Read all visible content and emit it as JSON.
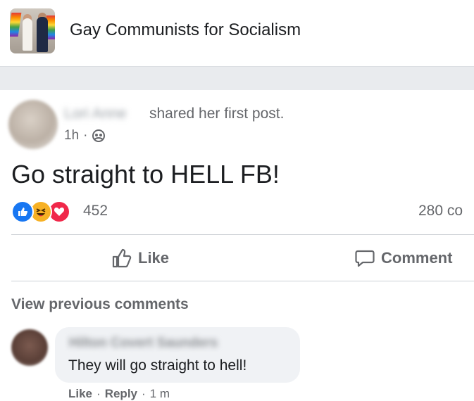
{
  "group": {
    "name": "Gay Communists for Socialism"
  },
  "post": {
    "author": "Lori Anne",
    "action": "shared her first post.",
    "time": "1h",
    "meta_separator": "·",
    "text": "Go straight to HELL FB!",
    "reaction_count": "452",
    "comment_count": "280 co",
    "reactions": [
      "like",
      "haha",
      "love"
    ],
    "actions": {
      "like_label": "Like",
      "comment_label": "Comment"
    }
  },
  "comments": {
    "view_previous": "View previous comments",
    "items": [
      {
        "author": "Hilton Covert Saunders",
        "text": "They will go straight to hell!",
        "like_label": "Like",
        "reply_label": "Reply",
        "separator": "·",
        "time": "1 m"
      }
    ]
  },
  "colors": {
    "like_blue": "#1877f2",
    "haha_yellow": "#f7b125",
    "love_red": "#f0284a",
    "secondary_text": "#65676b"
  }
}
